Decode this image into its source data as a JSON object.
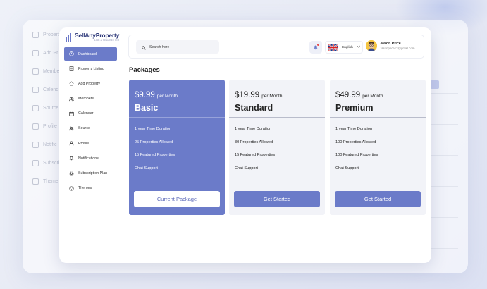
{
  "brand": {
    "name": "SellAnyProperty",
    "tagline": "LIVE & SELL BETTER"
  },
  "background_sidebar": [
    "Property",
    "Add Pr",
    "Membe",
    "Calend",
    "Source",
    "Profile",
    "Notific",
    "Subscri",
    "Theme"
  ],
  "sidebar": {
    "items": [
      {
        "label": "Dashboard",
        "icon": "clock-icon",
        "active": true
      },
      {
        "label": "Property Listing",
        "icon": "book-icon",
        "active": false
      },
      {
        "label": "Add Property",
        "icon": "add-home-icon",
        "active": false
      },
      {
        "label": "Members",
        "icon": "users-icon",
        "active": false
      },
      {
        "label": "Calendar",
        "icon": "calendar-icon",
        "active": false
      },
      {
        "label": "Source",
        "icon": "users-icon",
        "active": false
      },
      {
        "label": "Profile",
        "icon": "user-icon",
        "active": false
      },
      {
        "label": "Notifications",
        "icon": "bell-icon",
        "active": false
      },
      {
        "label": "Subscription Plan",
        "icon": "gear-icon",
        "active": false
      },
      {
        "label": "Themes",
        "icon": "palette-icon",
        "active": false
      }
    ]
  },
  "header": {
    "search_placeholder": "Search here",
    "language": "English",
    "user_name": "Jason Price",
    "user_email": "Jasonprice17@gmail.com"
  },
  "page": {
    "title": "Packages"
  },
  "packages": [
    {
      "price": "$9.99",
      "period": "per Month",
      "name": "Basic",
      "features": [
        "1 year Time Duration",
        "25 Properties Allowed",
        "15 Featured Properties",
        "Chat Support"
      ],
      "cta": "Current Package",
      "current": true
    },
    {
      "price": "$19.99",
      "period": "per Month",
      "name": "Standard",
      "features": [
        "1 year Time Duration",
        "30 Properties Allowed",
        "15 Featured Properties",
        "Chat Support"
      ],
      "cta": "Get Started",
      "current": false
    },
    {
      "price": "$49.99",
      "period": "per Month",
      "name": "Premium",
      "features": [
        "1 year Time Duration",
        "100 Properties Allowed",
        "100 Featured Properties",
        "Chat Support"
      ],
      "cta": "Get Started",
      "current": false
    }
  ],
  "colors": {
    "accent": "#6b7bc9",
    "card_bg": "#f2f3f8",
    "brand_text": "#2f3a7a"
  }
}
